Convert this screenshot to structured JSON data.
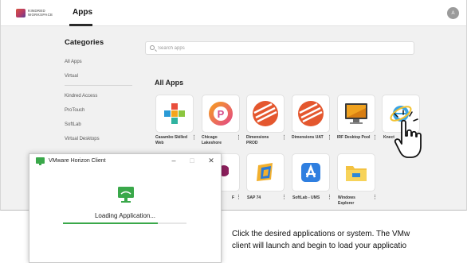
{
  "header": {
    "logo_line1": "KINDRED",
    "logo_line2": "WORKSPACE",
    "active_tab": "Apps",
    "avatar_initial": "A"
  },
  "sidebar": {
    "title": "Categories",
    "group1": [
      "All Apps",
      "Virtual"
    ],
    "group2": [
      "Kindred Access",
      "ProTouch",
      "SoftLab",
      "Virtual Desktops"
    ]
  },
  "search": {
    "placeholder": "Search apps"
  },
  "section_title": "All Apps",
  "apps_row1": [
    {
      "name": "Casambo Skilled Web",
      "icon": "casambo-cross-icon"
    },
    {
      "name": "Chicago Lakeshore",
      "icon": "chicago-lakeshore-icon"
    },
    {
      "name": "Dimensions PROD",
      "icon": "dimensions-prod-icon"
    },
    {
      "name": "Dimensions UAT",
      "icon": "dimensions-uat-icon"
    },
    {
      "name": "IRF Desktop Pool",
      "icon": "desktop-monitor-icon"
    },
    {
      "name": "Knect",
      "icon": "internet-explorer-icon"
    }
  ],
  "apps_row2": [
    {
      "name": "F",
      "icon": "partial-app-icon"
    },
    {
      "name": "SAP 74",
      "icon": "sap-icon"
    },
    {
      "name": "SoftLab - UMS",
      "icon": "app-store-icon"
    },
    {
      "name": "Windows Explorer",
      "icon": "folder-icon"
    }
  ],
  "dialog": {
    "title": "VMware Horizon Client",
    "minimize": "–",
    "maximize": "□",
    "close": "✕",
    "loading_text": "Loading Application...",
    "progress": 0.77
  },
  "caption": {
    "line1": "Click the desired applications or system.  The VMw",
    "line2": "client will launch and begin to load your applicatio"
  },
  "colors": {
    "accent_green": "#3aa84a",
    "dimensions_orange": "#e4572e"
  }
}
